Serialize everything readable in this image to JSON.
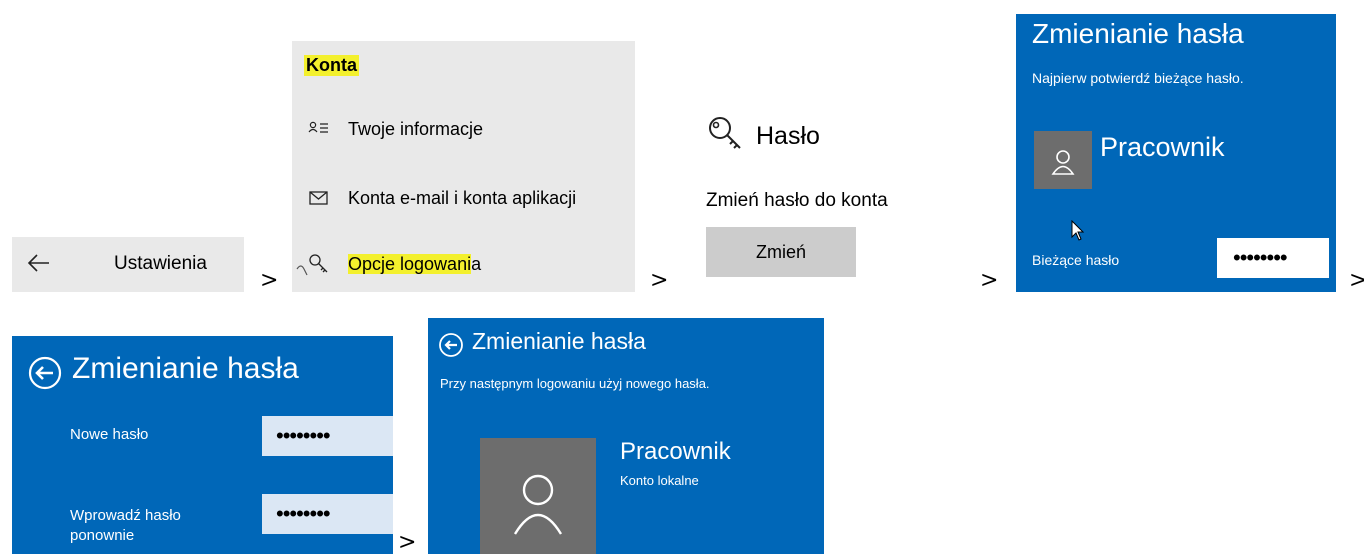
{
  "panel1": {
    "back_icon": "arrow-left-icon",
    "title": "Ustawienia"
  },
  "panel2": {
    "heading": "Konta",
    "items": [
      {
        "icon": "person-list-icon",
        "label": "Twoje informacje"
      },
      {
        "icon": "envelope-icon",
        "label": "Konta e-mail i konta aplikacji"
      },
      {
        "icon": "key-icon",
        "label_highlighted": "Opcje logowani",
        "label_rest": "a"
      }
    ],
    "highlight_color": "#f3f02d"
  },
  "panel3": {
    "icon": "key-icon",
    "title": "Hasło",
    "subtitle": "Zmień hasło do konta",
    "button": "Zmień"
  },
  "panel4": {
    "title": "Zmienianie hasła",
    "subtitle": "Najpierw potwierdź bieżące hasło.",
    "user_name": "Pracownik",
    "field_label": "Bieżące hasło",
    "field_value": "••••••••"
  },
  "panel5": {
    "back_icon": "circle-arrow-left-icon",
    "title": "Zmienianie hasła",
    "new_password_label": "Nowe hasło",
    "new_password_value": "••••••••",
    "confirm_label": "Wprowadź hasło ponownie",
    "confirm_value": "••••••••"
  },
  "panel6": {
    "back_icon": "circle-arrow-left-icon",
    "title": "Zmienianie hasła",
    "subtitle": "Przy następnym logowaniu użyj nowego hasła.",
    "user_name": "Pracownik",
    "account_type": "Konto lokalne"
  },
  "separators": [
    ">",
    ">",
    ">",
    ">",
    ">",
    ">"
  ],
  "colors": {
    "blue": "#0067b8",
    "gray_panel": "#e9e9e9",
    "button_gray": "#cccccc",
    "avatar_gray": "#6d6d6d"
  }
}
